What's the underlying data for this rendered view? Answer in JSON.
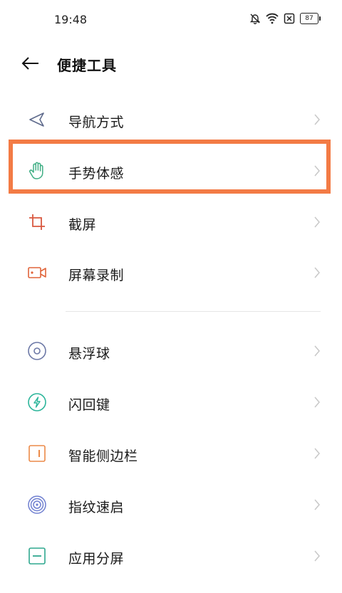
{
  "status": {
    "time": "19:48",
    "battery": "87"
  },
  "header": {
    "title": "便捷工具"
  },
  "items": [
    {
      "label": "导航方式",
      "icon": "navigation-arrow-icon"
    },
    {
      "label": "手势体感",
      "icon": "hand-gesture-icon"
    },
    {
      "label": "截屏",
      "icon": "crop-screenshot-icon"
    },
    {
      "label": "屏幕录制",
      "icon": "screen-record-icon"
    },
    {
      "label": "悬浮球",
      "icon": "floating-ball-icon"
    },
    {
      "label": "闪回键",
      "icon": "flash-back-icon"
    },
    {
      "label": "智能侧边栏",
      "icon": "smart-sidebar-icon"
    },
    {
      "label": "指纹速启",
      "icon": "fingerprint-icon"
    },
    {
      "label": "应用分屏",
      "icon": "split-screen-icon"
    }
  ],
  "colors": {
    "highlight": "#f37b45",
    "nav_icon": "#5e6a8c",
    "gesture_icon": "#3fae84",
    "crop_icon": "#d9573f",
    "record_icon": "#e0643a",
    "floating_icon": "#6c78a6",
    "flash_icon": "#2bb59a",
    "sidebar_icon": "#ec8a48",
    "fingerprint_icon": "#6f7fd0",
    "split_icon": "#2fa88f"
  }
}
